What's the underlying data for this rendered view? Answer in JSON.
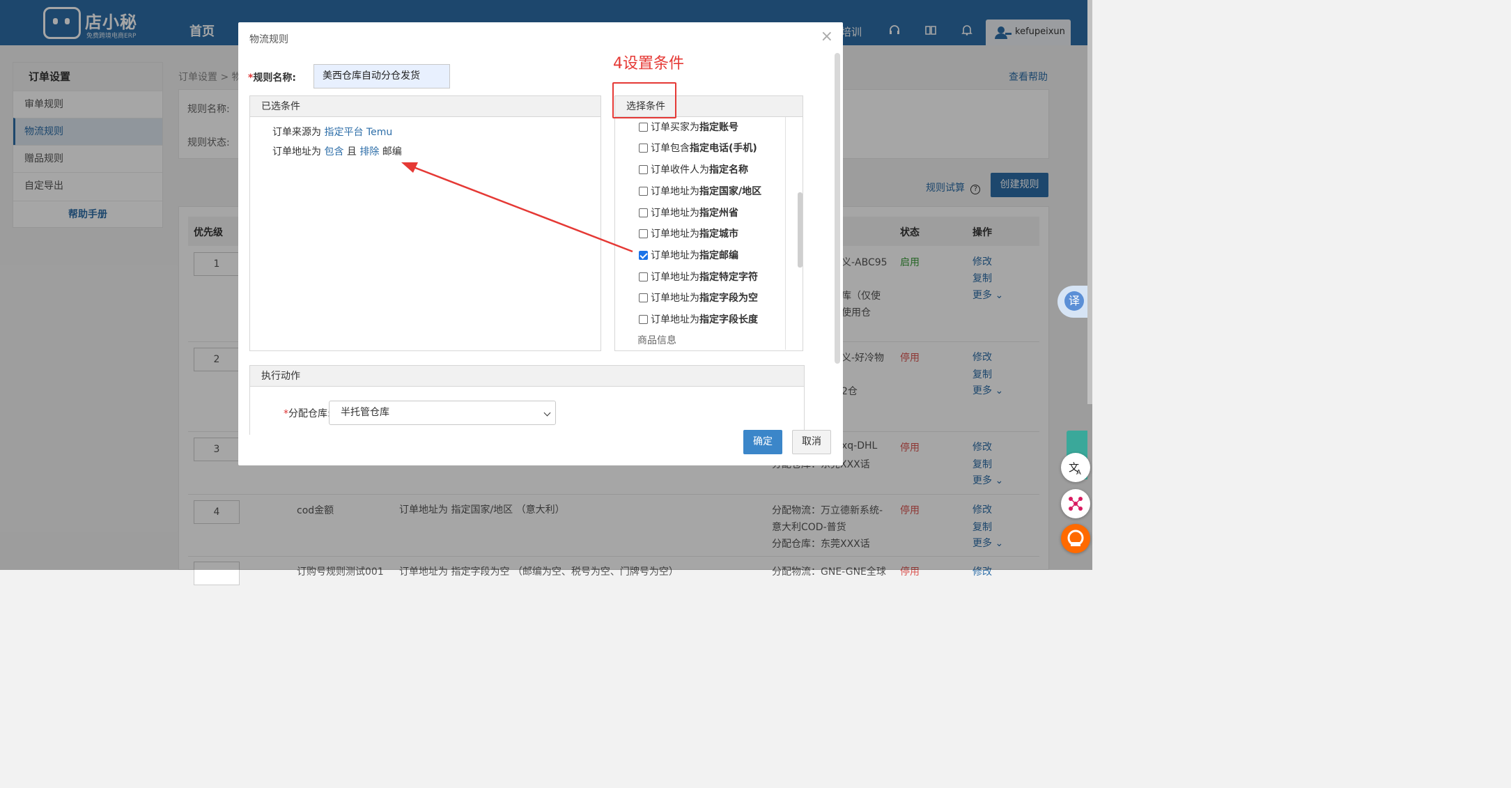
{
  "app": {
    "logo_text": "店小秘",
    "logo_sub": "免费跨境电商ERP",
    "nav_home": "首页",
    "nav_training": "培训",
    "username": "kefupeixun"
  },
  "sidebar": {
    "header": "订单设置",
    "items": [
      {
        "label": "审单规则",
        "active": false
      },
      {
        "label": "物流规则",
        "active": true
      },
      {
        "label": "赠品规则",
        "active": false
      },
      {
        "label": "自定导出",
        "active": false
      }
    ],
    "help": "帮助手册"
  },
  "page": {
    "breadcrumb": "订单设置 > 物",
    "help_link": "查看帮助",
    "filter_rule_name": "规则名称:",
    "filter_rule_status": "规则状态:",
    "rule_try": "规则试算",
    "create_rule": "创建规则",
    "table": {
      "headers": {
        "priority": "优先级",
        "status": "状态",
        "ops": "操作"
      },
      "rows": [
        {
          "priority": "1",
          "name": "",
          "cond": "",
          "action_lines": [
            "义-ABC95",
            "库（仅使",
            "使用仓"
          ],
          "status": "启用",
          "ops": [
            "修改",
            "复制",
            "更多"
          ]
        },
        {
          "priority": "2",
          "name": "",
          "cond": "",
          "action_lines": [
            "义-好冷物",
            "",
            "2仓"
          ],
          "status": "停用",
          "ops": [
            "修改",
            "复制",
            "更多"
          ]
        },
        {
          "priority": "3",
          "name": "",
          "cond": "",
          "action_lines": [
            "xq-DHL",
            "分配仓库：东莞XXX话"
          ],
          "status": "停用",
          "ops": [
            "修改",
            "复制",
            "更多"
          ]
        },
        {
          "priority": "4",
          "name": "cod金额",
          "cond": "订单地址为 指定国家/地区 （意大利）",
          "action_lines": [
            "分配物流：万立德新系统-",
            "意大利COD-普货",
            "分配仓库：东莞XXX话"
          ],
          "status": "停用",
          "ops": [
            "修改",
            "复制",
            "更多"
          ]
        },
        {
          "priority": "",
          "name": "订购号规则测试001",
          "cond": "订单地址为 指定字段为空 （邮编为空、税号为空、门牌号为空）",
          "action_lines": [
            "分配物流：GNE-GNE全球"
          ],
          "status": "停用",
          "ops": [
            "修改"
          ]
        }
      ]
    }
  },
  "modal": {
    "title": "物流规则",
    "close": "×",
    "rule_name_label": "规则名称:",
    "rule_name_value": "美西仓库自动分仓发货",
    "selected_conditions": {
      "header": "已选条件",
      "lines": [
        {
          "prefix": "订单来源为 ",
          "link1": "指定平台 Temu",
          "mid": "",
          "link2": "",
          "suffix": ""
        },
        {
          "prefix": "订单地址为 ",
          "link1": "包含",
          "mid": " 且 ",
          "link2": "排除",
          "suffix": " 邮编"
        }
      ]
    },
    "choose_conditions": {
      "header": "选择条件",
      "options": [
        {
          "prefix": "订单买家为",
          "bold": "指定账号",
          "checked": false
        },
        {
          "prefix": "订单包含",
          "bold": "指定电话(手机)",
          "checked": false
        },
        {
          "prefix": "订单收件人为",
          "bold": "指定名称",
          "checked": false
        },
        {
          "prefix": "订单地址为",
          "bold": "指定国家/地区",
          "checked": false
        },
        {
          "prefix": "订单地址为",
          "bold": "指定州省",
          "checked": false
        },
        {
          "prefix": "订单地址为",
          "bold": "指定城市",
          "checked": false
        },
        {
          "prefix": "订单地址为",
          "bold": "指定邮编",
          "checked": true
        },
        {
          "prefix": "订单地址为",
          "bold": "指定特定字符",
          "checked": false
        },
        {
          "prefix": "订单地址为",
          "bold": "指定字段为空",
          "checked": false
        },
        {
          "prefix": "订单地址为",
          "bold": "指定字段长度",
          "checked": false
        }
      ],
      "group_label": "商品信息"
    },
    "action": {
      "header": "执行动作",
      "warehouse_label": "分配仓库:",
      "warehouse_value": "半托管仓库"
    },
    "ok": "确定",
    "cancel": "取消"
  },
  "annotation": {
    "text": "4设置条件",
    "color": "#e53935"
  },
  "floaters": {
    "translate": "译"
  },
  "colors": {
    "primary": "#2d6ea8",
    "enabled": "#3a9b3a",
    "disabled": "#d9534f"
  }
}
